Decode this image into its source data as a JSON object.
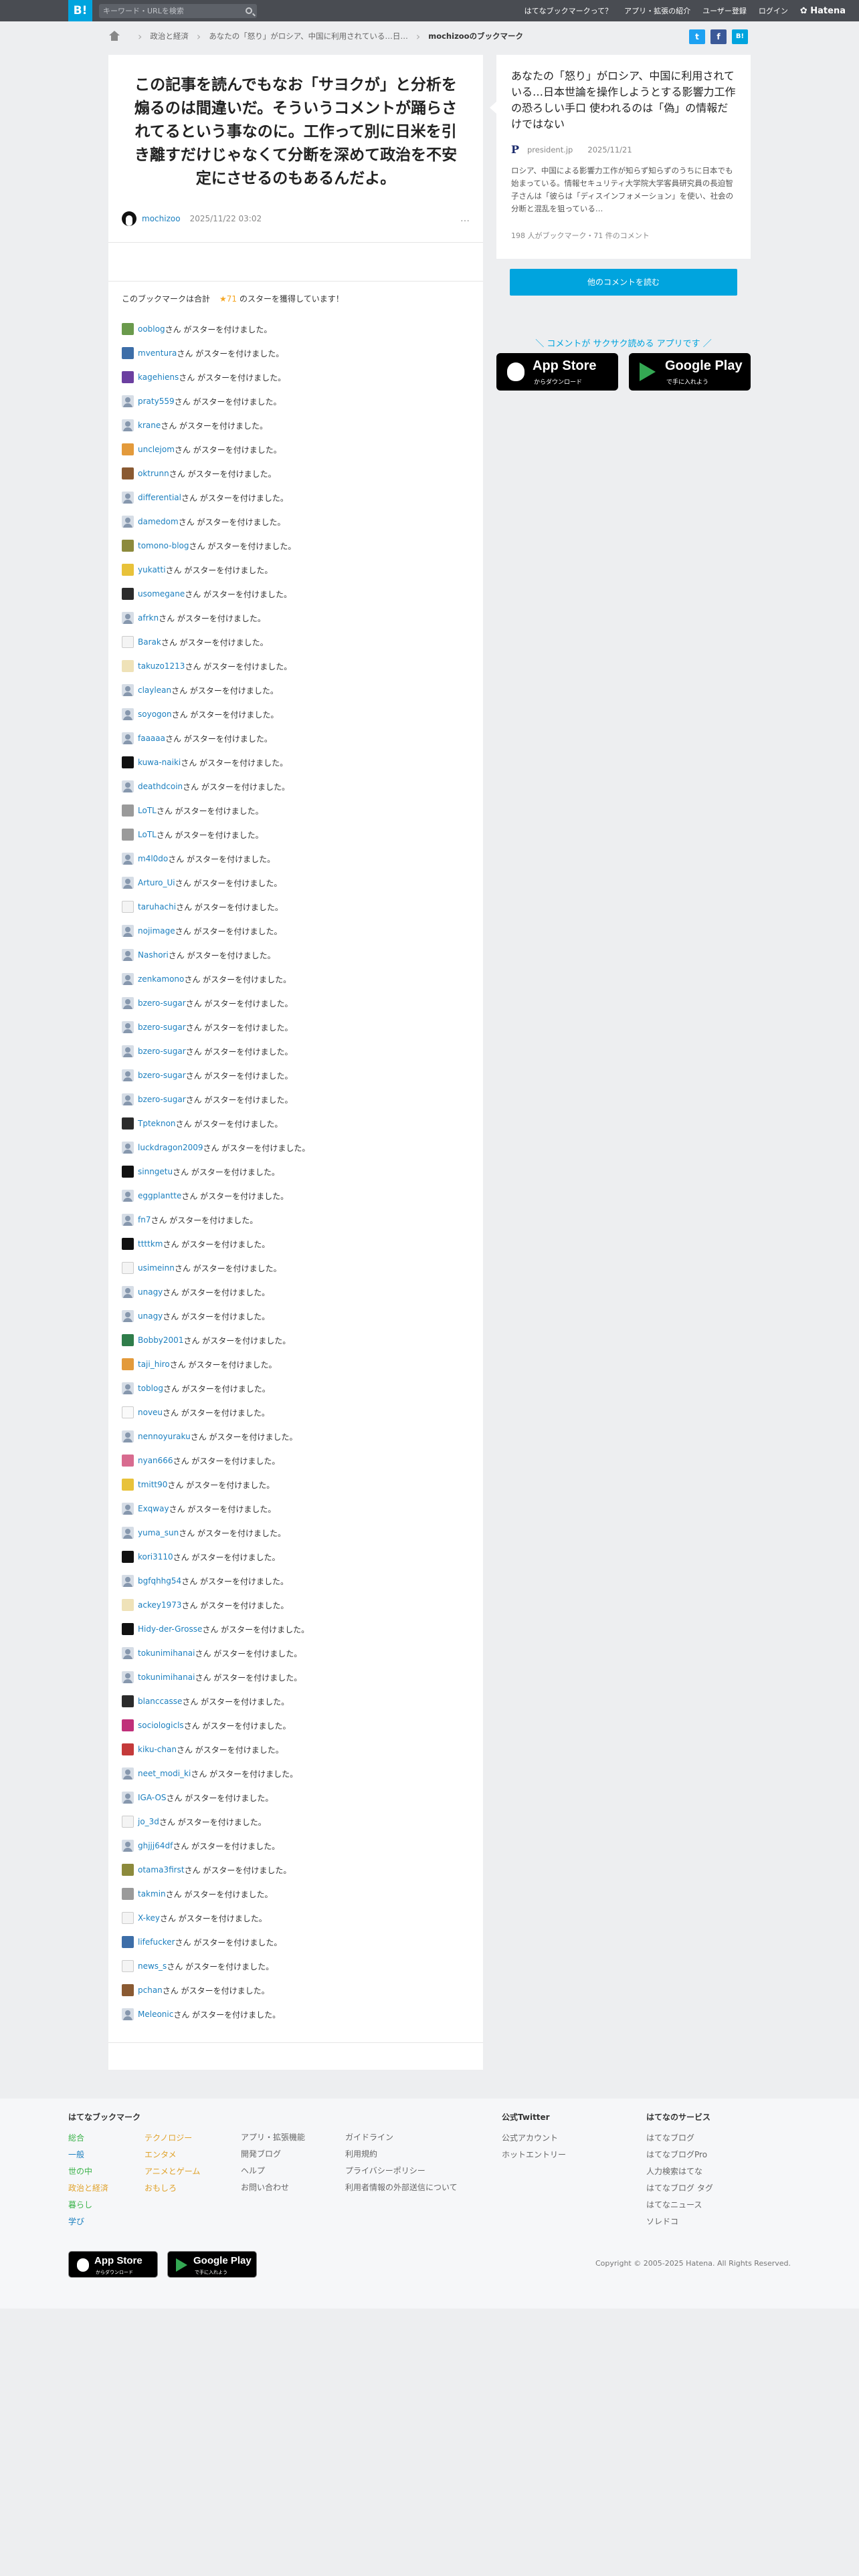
{
  "topbar": {
    "logo": "B!",
    "search_placeholder": "キーワード・URLを検索",
    "nav": [
      "はてなブックマークって？",
      "アプリ・拡張の紹介",
      "ユーザー登録",
      "ログイン",
      "Hatena"
    ]
  },
  "breadcrumb": {
    "items": [
      "政治と経済",
      "あなたの「怒り」がロシア、中国に利用されている…日…",
      "mochizooのブックマーク"
    ]
  },
  "share": {
    "twitter": "t",
    "facebook": "f",
    "hatena": "B!"
  },
  "bookmark": {
    "comment": "この記事を読んでもなお「サヨクが」と分析を煽るのは間違いだ。そういうコメントが踊らされてるという事なのに。工作って別に日米を引き離すだけじゃなくて分断を深めて政治を不安定にさせるのもあるんだよ。",
    "user": "mochizoo",
    "date": "2025/11/22 03:02",
    "more": "…",
    "star_summary_pre": "このブックマークは合計",
    "star_total": "★71",
    "star_summary_post": "のスターを獲得しています！",
    "suffix": "さん がスターを付けました。"
  },
  "stars": [
    {
      "user": "ooblog",
      "icon": "av-grn"
    },
    {
      "user": "mventura",
      "icon": "av-blue"
    },
    {
      "user": "kagehiens",
      "icon": "av-purple"
    },
    {
      "user": "praty559",
      "icon": "default"
    },
    {
      "user": "krane",
      "icon": "default"
    },
    {
      "user": "unclejom",
      "icon": "av-orange"
    },
    {
      "user": "oktrunn",
      "icon": "av-brown"
    },
    {
      "user": "differential",
      "icon": "default"
    },
    {
      "user": "damedom",
      "icon": "default"
    },
    {
      "user": "tomono-blog",
      "icon": "av-olive"
    },
    {
      "user": "yukatti",
      "icon": "av-yellow"
    },
    {
      "user": "usomegane",
      "icon": "av-dark"
    },
    {
      "user": "afrkn",
      "icon": "default"
    },
    {
      "user": "Barak",
      "icon": "av-sketch"
    },
    {
      "user": "takuzo1213",
      "icon": "av-cream"
    },
    {
      "user": "claylean",
      "icon": "default"
    },
    {
      "user": "soyogon",
      "icon": "default"
    },
    {
      "user": "faaaaa",
      "icon": "default"
    },
    {
      "user": "kuwa-naiki",
      "icon": "av-black"
    },
    {
      "user": "deathdcoin",
      "icon": "default"
    },
    {
      "user": "LoTL",
      "icon": "av-gray"
    },
    {
      "user": "LoTL",
      "icon": "av-gray"
    },
    {
      "user": "m4l0do",
      "icon": "default"
    },
    {
      "user": "Arturo_Ui",
      "icon": "default"
    },
    {
      "user": "taruhachi",
      "icon": "av-sketch"
    },
    {
      "user": "nojimage",
      "icon": "default"
    },
    {
      "user": "Nashori",
      "icon": "default"
    },
    {
      "user": "zenkamono",
      "icon": "default"
    },
    {
      "user": "bzero-sugar",
      "icon": "default"
    },
    {
      "user": "bzero-sugar",
      "icon": "default"
    },
    {
      "user": "bzero-sugar",
      "icon": "default"
    },
    {
      "user": "bzero-sugar",
      "icon": "default"
    },
    {
      "user": "bzero-sugar",
      "icon": "default"
    },
    {
      "user": "Tpteknon",
      "icon": "av-dark"
    },
    {
      "user": "luckdragon2009",
      "icon": "default"
    },
    {
      "user": "sinngetu",
      "icon": "av-black"
    },
    {
      "user": "eggplantte",
      "icon": "default"
    },
    {
      "user": "fn7",
      "icon": "default"
    },
    {
      "user": "ttttkm",
      "icon": "av-black"
    },
    {
      "user": "usimeinn",
      "icon": "av-sketch"
    },
    {
      "user": "unagy",
      "icon": "default"
    },
    {
      "user": "unagy",
      "icon": "default"
    },
    {
      "user": "Bobby2001",
      "icon": "av-green"
    },
    {
      "user": "taji_hiro",
      "icon": "av-orange"
    },
    {
      "user": "toblog",
      "icon": "default"
    },
    {
      "user": "noveu",
      "icon": "av-white"
    },
    {
      "user": "nennoyuraku",
      "icon": "default"
    },
    {
      "user": "nyan666",
      "icon": "av-pink"
    },
    {
      "user": "tmitt90",
      "icon": "av-yellow"
    },
    {
      "user": "Exqway",
      "icon": "default"
    },
    {
      "user": "yuma_sun",
      "icon": "default"
    },
    {
      "user": "kori3110",
      "icon": "av-black"
    },
    {
      "user": "bgfqhhg54",
      "icon": "default"
    },
    {
      "user": "ackey1973",
      "icon": "av-cream"
    },
    {
      "user": "Hidy-der-Grosse",
      "icon": "av-black"
    },
    {
      "user": "tokunimihanai",
      "icon": "default"
    },
    {
      "user": "tokunimihanai",
      "icon": "default"
    },
    {
      "user": "blanccasse",
      "icon": "av-dark"
    },
    {
      "user": "sociologicls",
      "icon": "av-magenta"
    },
    {
      "user": "kiku-chan",
      "icon": "av-red"
    },
    {
      "user": "neet_modi_ki",
      "icon": "default"
    },
    {
      "user": "IGA-OS",
      "icon": "default"
    },
    {
      "user": "jo_3d",
      "icon": "av-sketch"
    },
    {
      "user": "ghjjj64df",
      "icon": "default"
    },
    {
      "user": "otama3first",
      "icon": "av-olive"
    },
    {
      "user": "takmin",
      "icon": "av-gray"
    },
    {
      "user": "X-key",
      "icon": "av-sketch"
    },
    {
      "user": "lifefucker",
      "icon": "av-blue"
    },
    {
      "user": "news_s",
      "icon": "av-sketch"
    },
    {
      "user": "pchan",
      "icon": "av-brown"
    },
    {
      "user": "Meleonic",
      "icon": "default"
    }
  ],
  "entry": {
    "title": "あなたの「怒り」がロシア、中国に利用されている…日本世論を操作しようとする影響力工作の恐ろしい手口 使われるのは「偽」の情報だけではない",
    "favicon": "P",
    "source": "president.jp",
    "date": "2025/11/21",
    "desc": "ロシア、中国による影響力工作が知らず知らずのうちに日本でも始まっている。情報セキュリティ大学院大学客員研究員の長迫智子さんは「彼らは「ディスインフォメーション」を使い、社会の分断と混乱を狙っている…",
    "count": "198 人がブックマーク・71 件のコメント",
    "button": "他のコメントを読む"
  },
  "promo": {
    "text": "コメントが サクサク読める アプリです",
    "appstore_big": "App Store",
    "appstore_small": "からダウンロード",
    "gplay_big": "Google Play",
    "gplay_small": "で手に入れよう"
  },
  "footer": {
    "col1_head": "はてなブックマーク",
    "col1a": [
      "総合",
      "一般",
      "世の中",
      "政治と経済",
      "暮らし",
      "学び"
    ],
    "col1b": [
      "テクノロジー",
      "エンタメ",
      "アニメとゲーム",
      "おもしろ"
    ],
    "col2": [
      "アプリ・拡張機能",
      "開発ブログ",
      "ヘルプ",
      "お問い合わせ"
    ],
    "col3": [
      "ガイドライン",
      "利用規約",
      "プライバシーポリシー",
      "利用者情報の外部送信について"
    ],
    "col4_head": "公式Twitter",
    "col4": [
      "公式アカウント",
      "ホットエントリー"
    ],
    "col5_head": "はてなのサービス",
    "col5": [
      "はてなブログ",
      "はてなブログPro",
      "人力検索はてな",
      "はてなブログ タグ",
      "はてなニュース",
      "ソレドコ"
    ],
    "copyright": "Copyright © 2005-2025 Hatena. All Rights Reserved."
  },
  "colors": {
    "accent": "#00a4de",
    "link": "#1b7fbf",
    "star": "#f5a623",
    "topbar": "#494c52"
  }
}
